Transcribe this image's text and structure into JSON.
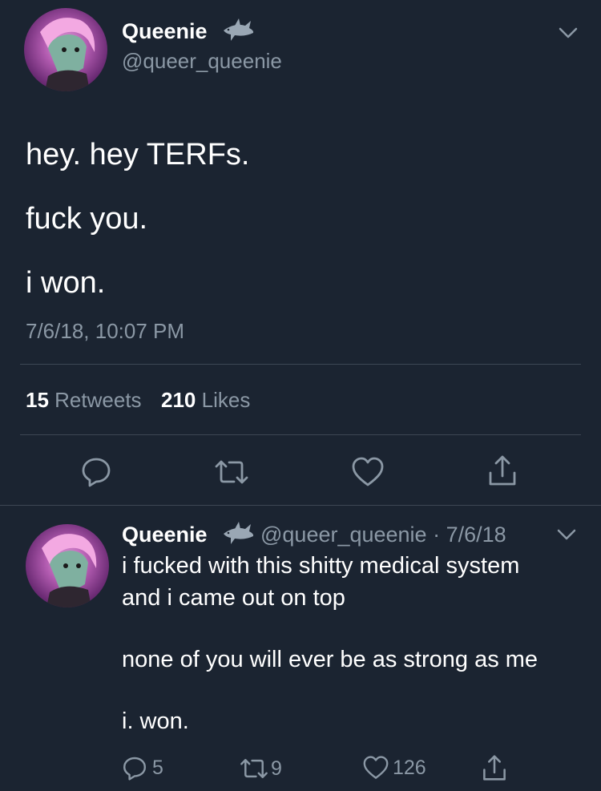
{
  "main_tweet": {
    "display_name": "Queenie",
    "handle": "@queer_queenie",
    "badge_icon": "shark-icon",
    "lines": [
      "hey. hey TERFs.",
      "fuck you.",
      "i won."
    ],
    "timestamp": "7/6/18, 10:07 PM",
    "retweet_count": "15",
    "retweet_label": "Retweets",
    "like_count": "210",
    "like_label": "Likes",
    "actions": [
      "reply-icon",
      "retweet-icon",
      "heart-icon",
      "share-icon"
    ]
  },
  "reply_tweet": {
    "display_name": "Queenie",
    "handle_date": "@queer_queenie · 7/6/18",
    "badge_icon": "shark-icon",
    "lines": [
      "i fucked with this shitty medical system",
      "and i came out on top",
      "none of you will ever be as strong as me",
      "i. won."
    ],
    "reply_count": "5",
    "retweet_count": "9",
    "like_count": "126",
    "actions": [
      "reply-icon",
      "retweet-icon",
      "heart-icon",
      "share-icon"
    ]
  },
  "colors": {
    "background": "#1b2431",
    "text": "#ffffff",
    "muted": "#8b98a5",
    "divider": "#3d4754"
  }
}
